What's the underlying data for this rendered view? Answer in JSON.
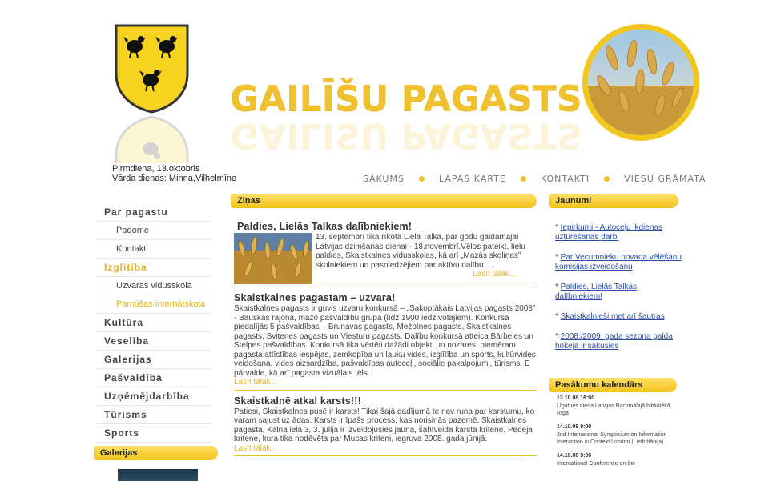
{
  "header": {
    "title": "GAILĪŠU PAGASTS",
    "date": "Pirmdiena, 13.oktobris",
    "namedays": "Vārda dienas: Minna,Vilhelmīne"
  },
  "topnav": [
    "SĀKUMS",
    "LAPAS KARTE",
    "KONTAKTI",
    "VIESU GRĀMATA"
  ],
  "leftmenu": [
    {
      "label": "Par pagastu",
      "level": 0,
      "active": false
    },
    {
      "label": "Padome",
      "level": 1,
      "active": false
    },
    {
      "label": "Kontakti",
      "level": 1,
      "active": false
    },
    {
      "label": "Izglītība",
      "level": 0,
      "active": true
    },
    {
      "label": "Uzvaras vidusskola",
      "level": 1,
      "active": false
    },
    {
      "label": "Pamūšas internātskola",
      "level": 1,
      "active": true
    },
    {
      "label": "Kultūra",
      "level": 0,
      "active": false
    },
    {
      "label": "Veselība",
      "level": 0,
      "active": false
    },
    {
      "label": "Galerijas",
      "level": 0,
      "active": false
    },
    {
      "label": "Pašvaldība",
      "level": 0,
      "active": false
    },
    {
      "label": "Uzņēmējdarbība",
      "level": 0,
      "active": false
    },
    {
      "label": "Tūrisms",
      "level": 0,
      "active": false
    },
    {
      "label": "Sports",
      "level": 0,
      "active": false
    }
  ],
  "galerijas_heading": "Galerijas",
  "news_heading": "Ziņas",
  "news": [
    {
      "title": "Paldies, Lielās Talkas dalībniekiem!",
      "body": "13. septembrī tika rīkota Lielā Talka, par  godu gaidāmajai Latvijas dzimšanas dienai - 18.novembrī.Vēlos pateikt, lielu paldies, Skaistkalnes vidusskolas, kā arī „Mazās skoliņas” skolniekiem un pasniedzējiem par aktīvu dalību ....",
      "more": "Lasīt tālāk..."
    },
    {
      "title": "Skaistkalnes pagastam – uzvara!",
      "body": "Skaistkalnes pagasts ir guvis uzvaru konkursā –  „Sakoptākais Latvijas pagasts 2008” - Bauskas rajonā, mazo pašvaldību grupā (līdz 1900 iedzīvotājiem). Konkursā piedalījās 5 pašvaldības – Brunavas pagasts, Mežotnes pagasts, Skaistkalnes pagasts, Svitenes pagasts un Viesturu pagasts. Dalību konkursā atteica Bārbeles un Stelpes pašvaldības. Konkursā tika vērtēti dažādi objekti un nozares, piemēram, pagasta attīstības iespējas, zemkopība un lauku vides, izglītība un sports, kultūrvides veidošana, vides aizsardzība, pašvaldības autoceļi, sociālie pakalpojumi, tūrisms. E pārvalde, kā arī pagasta vizuālais tēls.",
      "more": "Lasīt tālāk..."
    },
    {
      "title": "Skaistkalnē atkal karsts!!!",
      "body": "Patiesi, Skaistkalnes pusē ir karsts! Tikai šajā gadījumā te nav runa par karstumu, ko varam sajust uz ādas. Karsts ir īpašs process, kas norisinās pazemē. Skaistkalnes pagastā, Kalna ielā 3, 3. jūlijā ir izveidojusies jauna, šahtveida karsta  kritene. Pēdējā kritene, kura tika nodēvēta par Mucas kriteni, iegruva 2005. gada jūnijā.",
      "more": "Lasīt tālāk..."
    }
  ],
  "jaunumi_heading": "Jaunumi",
  "jaunumi": [
    "Iepirkumi - Autoceļu ikdienas uzturēšanas darbi",
    "Par Vecumnieku novada vēlēšanu komisijas izveidošanu",
    "Paldies, Lielās Talkas dalībniekiem!",
    "Skaistkalnieši met arī šautras",
    "2008./2009. gada sezona galda hokejā ir sākusies"
  ],
  "calendar_heading": "Pasākumu kalendārs",
  "events": [
    {
      "date": "13.10.08 16:00",
      "text": "Līgatnes diena Latvijas Nacionālajā bibliotēkā, Rīga"
    },
    {
      "date": "14.10.08 9:00",
      "text": "2nd International Symposium on Information Interaction in Context London (Lielbritānija)"
    },
    {
      "date": "14.10.08 9:00",
      "text": "International Conference on the"
    }
  ],
  "colors": {
    "accent": "#f0c21d",
    "link": "#2a4fa8",
    "active_menu": "#e6b417"
  }
}
